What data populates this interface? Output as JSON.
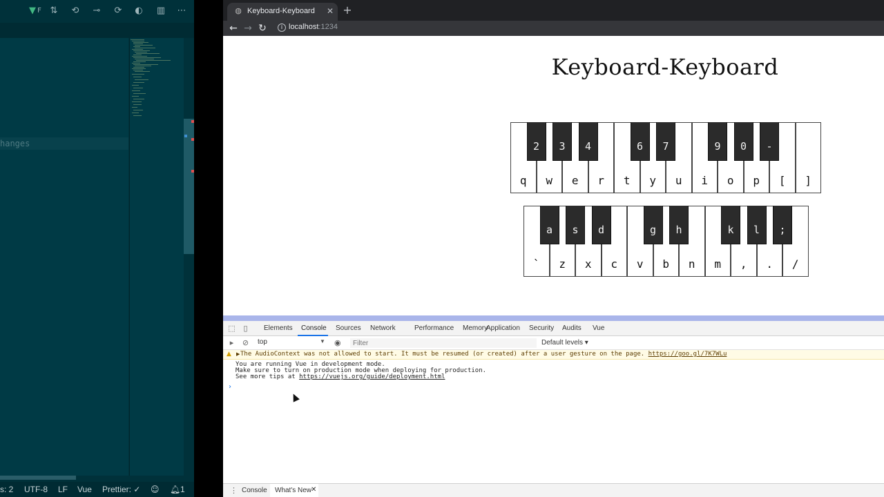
{
  "editor": {
    "changes_label": "hanges",
    "vue_badge": "F",
    "statusbar": {
      "spaces": "s: 2",
      "encoding": "UTF-8",
      "eol": "LF",
      "language": "Vue",
      "formatter": "Prettier: ✓",
      "notifications": "1"
    }
  },
  "browser": {
    "tab_title": "Keyboard-Keyboard",
    "address_host": "localhost",
    "address_port": ":1234"
  },
  "page": {
    "title": "Keyboard-Keyboard",
    "row1": {
      "white_keys": [
        "q",
        "w",
        "e",
        "r",
        "t",
        "y",
        "u",
        "i",
        "o",
        "p",
        "[",
        "]"
      ],
      "black_keys": [
        "2",
        "3",
        "4",
        "6",
        "7",
        "9",
        "0",
        "-"
      ]
    },
    "row2": {
      "white_keys": [
        "`",
        "z",
        "x",
        "c",
        "v",
        "b",
        "n",
        "m",
        ",",
        ".",
        "/"
      ],
      "black_keys": [
        "a",
        "s",
        "d",
        "g",
        "h",
        "k",
        "l",
        ";"
      ]
    }
  },
  "devtools": {
    "tabs": [
      "Elements",
      "Console",
      "Sources",
      "Network",
      "Performance",
      "Memory",
      "Application",
      "Security",
      "Audits",
      "Vue"
    ],
    "active_tab": "Console",
    "context": "top",
    "filter_placeholder": "Filter",
    "levels": "Default levels ▾",
    "warning": {
      "text": "The AudioContext was not allowed to start. It must be resumed (or created) after a user gesture on the page.",
      "link": "https://goo.gl/7K7WLu"
    },
    "log": {
      "line1": "You are running Vue in development mode.",
      "line2": "Make sure to turn on production mode when deploying for production.",
      "line3_prefix": "See more tips at",
      "line3_link": "https://vuejs.org/guide/deployment.html"
    },
    "drawer": {
      "tabs": [
        "Console",
        "What's New"
      ]
    }
  }
}
